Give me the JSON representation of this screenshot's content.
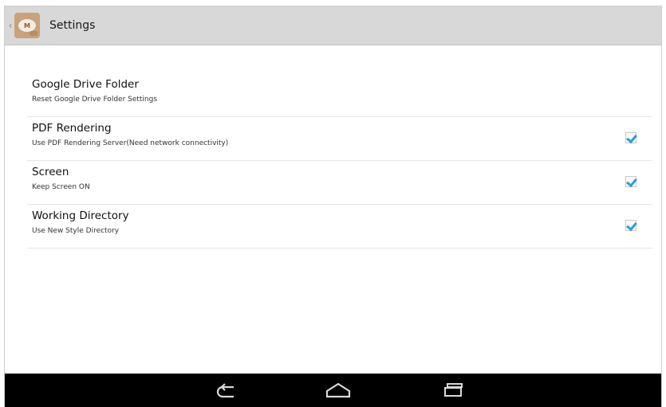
{
  "actionbar": {
    "title": "Settings",
    "app_icon_letter": "M"
  },
  "settings": [
    {
      "title": "Google Drive Folder",
      "summary": "Reset Google Drive Folder Settings",
      "checkbox": false
    },
    {
      "title": "PDF Rendering",
      "summary": "Use PDF Rendering Server(Need network connectivity)",
      "checkbox": true,
      "checked": true
    },
    {
      "title": "Screen",
      "summary": "Keep Screen ON",
      "checkbox": true,
      "checked": true
    },
    {
      "title": "Working Directory",
      "summary": "Use New Style Directory",
      "checkbox": true,
      "checked": true
    }
  ],
  "navbar": {
    "buttons": [
      "back-icon",
      "home-icon",
      "recents-icon"
    ]
  },
  "colors": {
    "accent": "#2a9fd6",
    "actionbar": "#d8d8d8",
    "navbar": "#000000"
  }
}
